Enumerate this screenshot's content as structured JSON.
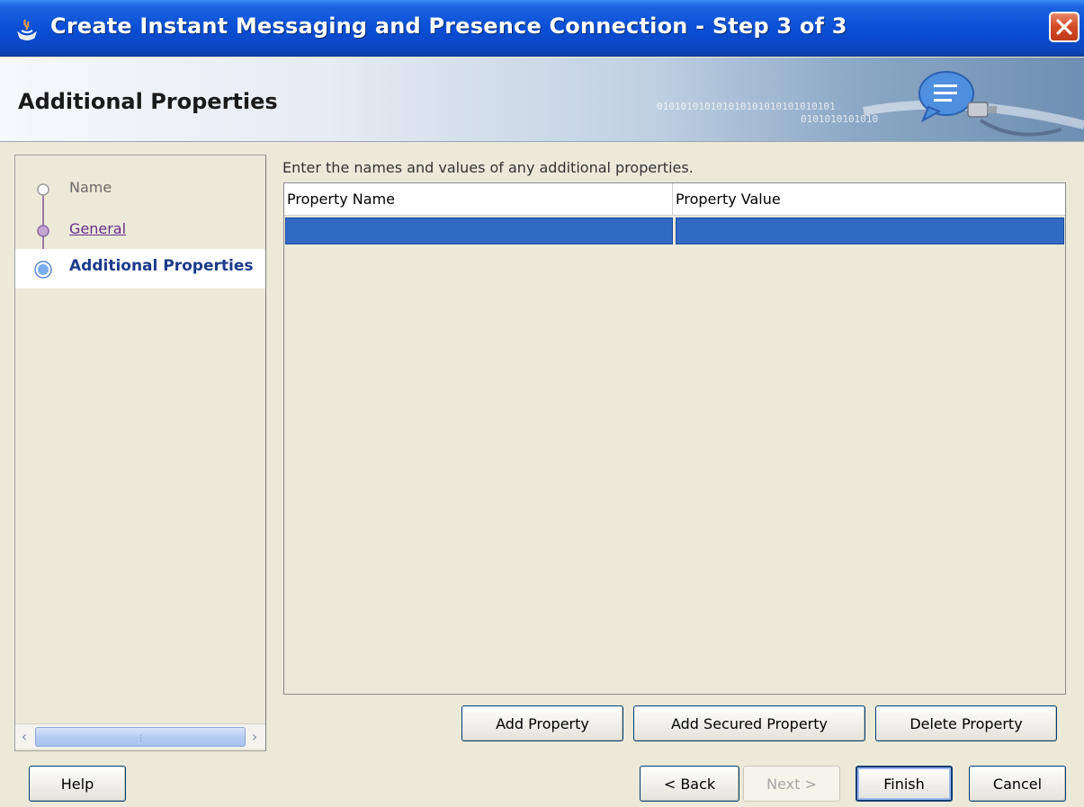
{
  "window": {
    "title": "Create Instant Messaging and Presence Connection - Step 3 of 3"
  },
  "banner": {
    "heading": "Additional Properties",
    "binary_line1": "010101010101010101010101010101",
    "binary_line2": "0101010101010"
  },
  "steps": [
    {
      "label": "Name",
      "state": "visited"
    },
    {
      "label": "General",
      "state": "link"
    },
    {
      "label": "Additional Properties",
      "state": "current"
    }
  ],
  "content": {
    "instruction": "Enter the names and values of any additional properties.",
    "table": {
      "columns": [
        "Property Name",
        "Property Value"
      ],
      "rows": [
        [
          "",
          ""
        ]
      ]
    }
  },
  "actions": {
    "add_property": "Add Property",
    "add_secured_property": "Add Secured Property",
    "delete_property": "Delete Property"
  },
  "footer": {
    "help": "Help",
    "back": "< Back",
    "next": "Next >",
    "finish": "Finish",
    "cancel": "Cancel"
  },
  "colors": {
    "titlebar": "#0a4fd6",
    "selection": "#316ac5",
    "step_current": "#1a3a8a",
    "step_link": "#6a2c8a"
  }
}
